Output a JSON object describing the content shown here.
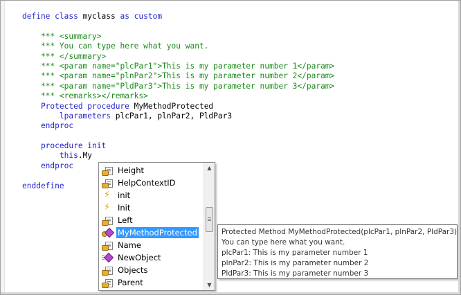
{
  "editor": {
    "lines": [
      [
        {
          "c": "kw",
          "t": "define class "
        },
        {
          "c": "tx",
          "t": "myclass"
        },
        {
          "c": "kw",
          "t": " as custom"
        }
      ],
      [],
      [
        {
          "c": "cm",
          "t": "    *** <summary>"
        }
      ],
      [
        {
          "c": "cm",
          "t": "    *** You can type here what you want."
        }
      ],
      [
        {
          "c": "cm",
          "t": "    *** </summary>"
        }
      ],
      [
        {
          "c": "cm",
          "t": "    *** <param name=\"plcPar1\">This is my parameter number 1</param>"
        }
      ],
      [
        {
          "c": "cm",
          "t": "    *** <param name=\"plnPar2\">This is my parameter number 2</param>"
        }
      ],
      [
        {
          "c": "cm",
          "t": "    *** <param name=\"PldPar3\">This is my parameter number 3</param>"
        }
      ],
      [
        {
          "c": "cm",
          "t": "    *** <remarks></remarks>"
        }
      ],
      [
        {
          "c": "kw",
          "t": "    Protected procedure "
        },
        {
          "c": "tx",
          "t": "MyMethodProtected"
        }
      ],
      [
        {
          "c": "kw",
          "t": "        lparameters "
        },
        {
          "c": "tx",
          "t": "plcPar1, plnPar2, PldPar3"
        }
      ],
      [
        {
          "c": "kw",
          "t": "    endproc"
        }
      ],
      [],
      [
        {
          "c": "kw",
          "t": "    procedure init"
        }
      ],
      [
        {
          "c": "kw",
          "t": "        this"
        },
        {
          "c": "tx",
          "t": ".My"
        }
      ],
      [
        {
          "c": "kw",
          "t": "    endproc"
        }
      ],
      [],
      [
        {
          "c": "kw",
          "t": "enddefine"
        }
      ]
    ]
  },
  "completion": {
    "items": [
      {
        "label": "Height",
        "icon": "property-icon"
      },
      {
        "label": "HelpContextID",
        "icon": "property-icon"
      },
      {
        "label": "init",
        "icon": "event-icon"
      },
      {
        "label": "Init",
        "icon": "event-icon"
      },
      {
        "label": "Left",
        "icon": "property-icon"
      },
      {
        "label": "MyMethodProtected",
        "icon": "protected-method-icon",
        "selected": true
      },
      {
        "label": "Name",
        "icon": "property-icon"
      },
      {
        "label": "NewObject",
        "icon": "method-icon"
      },
      {
        "label": "Objects",
        "icon": "property-icon"
      },
      {
        "label": "Parent",
        "icon": "property-icon"
      }
    ],
    "scroll_up": "▲",
    "scroll_down": "▼"
  },
  "tooltip": {
    "signature": "Protected Method MyMethodProtected(plcPar1, plnPar2, PldPar3)",
    "summary": "You can type here what you want.",
    "params": [
      "plcPar1: This is my parameter number 1",
      "plnPar2: This is my parameter number 2",
      "PldPar3: This is my parameter number 3"
    ]
  },
  "colors": {
    "keyword": "#1f1fcf",
    "comment": "#1a8a1a",
    "selection": "#3399ff"
  }
}
